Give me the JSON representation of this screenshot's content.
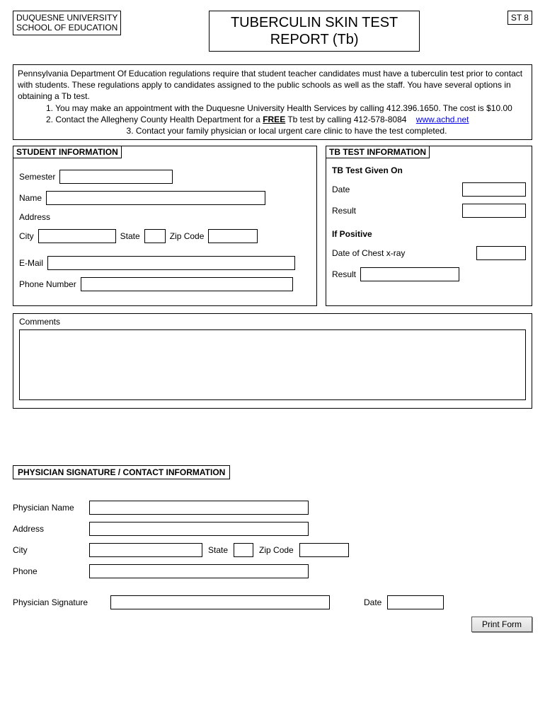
{
  "header": {
    "org_line1": "DUQUESNE UNIVERSITY",
    "org_line2": "SCHOOL OF EDUCATION",
    "title_line1": "TUBERCULIN SKIN TEST",
    "title_line2": "REPORT (Tb)",
    "st_code": "ST 8"
  },
  "instructions": {
    "para": "Pennsylvania Department Of Education regulations require that student teacher candidates must have a tuberculin test prior to contact with students. These regulations apply to candidates assigned to the public schools as well as the staff. You have several options in obtaining a Tb test.",
    "opt1": "1. You may make an appointment with the Duquesne University Health Services by calling 412.396.1650. The cost is $10.00",
    "opt2a": "2. Contact the Allegheny County Health Department for a ",
    "opt2_bold": "FREE",
    "opt2b": " Tb test by calling  412-578-8084",
    "opt2_link": "www.achd.net",
    "opt3": "3. Contact your family physician or local urgent care clinic to have the test completed."
  },
  "student": {
    "section_title": "STUDENT INFORMATION",
    "semester_label": "Semester",
    "name_label": "Name",
    "address_label": "Address",
    "city_label": "City",
    "state_label": "State",
    "zip_label": "Zip Code",
    "email_label": "E-Mail",
    "phone_label": "Phone Number"
  },
  "tb": {
    "section_title": "TB TEST INFORMATION",
    "given_on": "TB Test Given On",
    "date_label": "Date",
    "result_label": "Result",
    "if_positive": "If Positive",
    "xray_label": "Date of Chest x-ray",
    "result2_label": "Result"
  },
  "comments_label": "Comments",
  "physician": {
    "section_title": "PHYSICIAN SIGNATURE / CONTACT INFORMATION",
    "name_label": "Physician Name",
    "address_label": "Address",
    "city_label": "City",
    "state_label": "State",
    "zip_label": "Zip Code",
    "phone_label": "Phone",
    "sig_label": "Physician Signature",
    "date_label": "Date"
  },
  "print_button": "Print Form"
}
